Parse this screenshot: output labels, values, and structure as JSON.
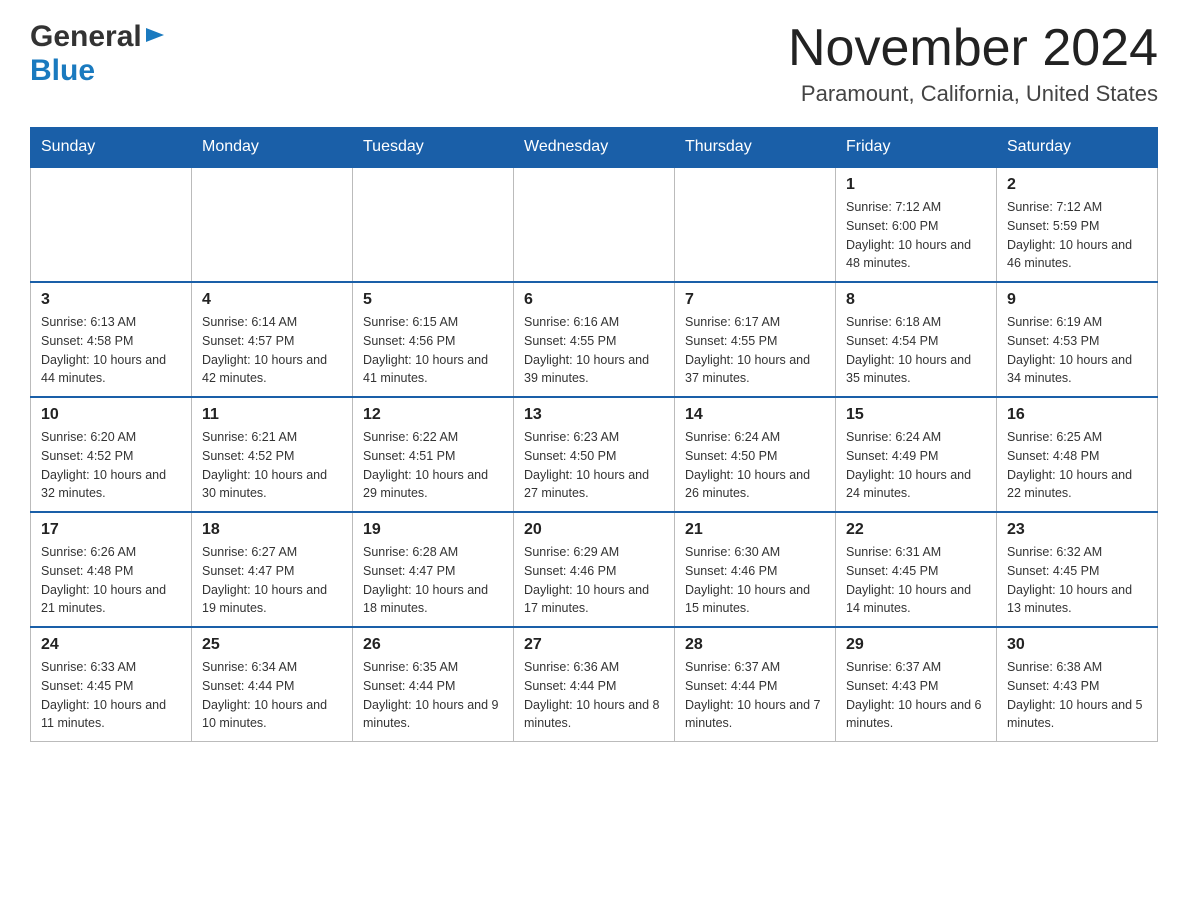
{
  "header": {
    "logo_general": "General",
    "logo_blue": "Blue",
    "month_title": "November 2024",
    "location": "Paramount, California, United States"
  },
  "weekdays": [
    "Sunday",
    "Monday",
    "Tuesday",
    "Wednesday",
    "Thursday",
    "Friday",
    "Saturday"
  ],
  "weeks": [
    [
      {
        "day": "",
        "info": ""
      },
      {
        "day": "",
        "info": ""
      },
      {
        "day": "",
        "info": ""
      },
      {
        "day": "",
        "info": ""
      },
      {
        "day": "",
        "info": ""
      },
      {
        "day": "1",
        "info": "Sunrise: 7:12 AM\nSunset: 6:00 PM\nDaylight: 10 hours and 48 minutes."
      },
      {
        "day": "2",
        "info": "Sunrise: 7:12 AM\nSunset: 5:59 PM\nDaylight: 10 hours and 46 minutes."
      }
    ],
    [
      {
        "day": "3",
        "info": "Sunrise: 6:13 AM\nSunset: 4:58 PM\nDaylight: 10 hours and 44 minutes."
      },
      {
        "day": "4",
        "info": "Sunrise: 6:14 AM\nSunset: 4:57 PM\nDaylight: 10 hours and 42 minutes."
      },
      {
        "day": "5",
        "info": "Sunrise: 6:15 AM\nSunset: 4:56 PM\nDaylight: 10 hours and 41 minutes."
      },
      {
        "day": "6",
        "info": "Sunrise: 6:16 AM\nSunset: 4:55 PM\nDaylight: 10 hours and 39 minutes."
      },
      {
        "day": "7",
        "info": "Sunrise: 6:17 AM\nSunset: 4:55 PM\nDaylight: 10 hours and 37 minutes."
      },
      {
        "day": "8",
        "info": "Sunrise: 6:18 AM\nSunset: 4:54 PM\nDaylight: 10 hours and 35 minutes."
      },
      {
        "day": "9",
        "info": "Sunrise: 6:19 AM\nSunset: 4:53 PM\nDaylight: 10 hours and 34 minutes."
      }
    ],
    [
      {
        "day": "10",
        "info": "Sunrise: 6:20 AM\nSunset: 4:52 PM\nDaylight: 10 hours and 32 minutes."
      },
      {
        "day": "11",
        "info": "Sunrise: 6:21 AM\nSunset: 4:52 PM\nDaylight: 10 hours and 30 minutes."
      },
      {
        "day": "12",
        "info": "Sunrise: 6:22 AM\nSunset: 4:51 PM\nDaylight: 10 hours and 29 minutes."
      },
      {
        "day": "13",
        "info": "Sunrise: 6:23 AM\nSunset: 4:50 PM\nDaylight: 10 hours and 27 minutes."
      },
      {
        "day": "14",
        "info": "Sunrise: 6:24 AM\nSunset: 4:50 PM\nDaylight: 10 hours and 26 minutes."
      },
      {
        "day": "15",
        "info": "Sunrise: 6:24 AM\nSunset: 4:49 PM\nDaylight: 10 hours and 24 minutes."
      },
      {
        "day": "16",
        "info": "Sunrise: 6:25 AM\nSunset: 4:48 PM\nDaylight: 10 hours and 22 minutes."
      }
    ],
    [
      {
        "day": "17",
        "info": "Sunrise: 6:26 AM\nSunset: 4:48 PM\nDaylight: 10 hours and 21 minutes."
      },
      {
        "day": "18",
        "info": "Sunrise: 6:27 AM\nSunset: 4:47 PM\nDaylight: 10 hours and 19 minutes."
      },
      {
        "day": "19",
        "info": "Sunrise: 6:28 AM\nSunset: 4:47 PM\nDaylight: 10 hours and 18 minutes."
      },
      {
        "day": "20",
        "info": "Sunrise: 6:29 AM\nSunset: 4:46 PM\nDaylight: 10 hours and 17 minutes."
      },
      {
        "day": "21",
        "info": "Sunrise: 6:30 AM\nSunset: 4:46 PM\nDaylight: 10 hours and 15 minutes."
      },
      {
        "day": "22",
        "info": "Sunrise: 6:31 AM\nSunset: 4:45 PM\nDaylight: 10 hours and 14 minutes."
      },
      {
        "day": "23",
        "info": "Sunrise: 6:32 AM\nSunset: 4:45 PM\nDaylight: 10 hours and 13 minutes."
      }
    ],
    [
      {
        "day": "24",
        "info": "Sunrise: 6:33 AM\nSunset: 4:45 PM\nDaylight: 10 hours and 11 minutes."
      },
      {
        "day": "25",
        "info": "Sunrise: 6:34 AM\nSunset: 4:44 PM\nDaylight: 10 hours and 10 minutes."
      },
      {
        "day": "26",
        "info": "Sunrise: 6:35 AM\nSunset: 4:44 PM\nDaylight: 10 hours and 9 minutes."
      },
      {
        "day": "27",
        "info": "Sunrise: 6:36 AM\nSunset: 4:44 PM\nDaylight: 10 hours and 8 minutes."
      },
      {
        "day": "28",
        "info": "Sunrise: 6:37 AM\nSunset: 4:44 PM\nDaylight: 10 hours and 7 minutes."
      },
      {
        "day": "29",
        "info": "Sunrise: 6:37 AM\nSunset: 4:43 PM\nDaylight: 10 hours and 6 minutes."
      },
      {
        "day": "30",
        "info": "Sunrise: 6:38 AM\nSunset: 4:43 PM\nDaylight: 10 hours and 5 minutes."
      }
    ]
  ]
}
